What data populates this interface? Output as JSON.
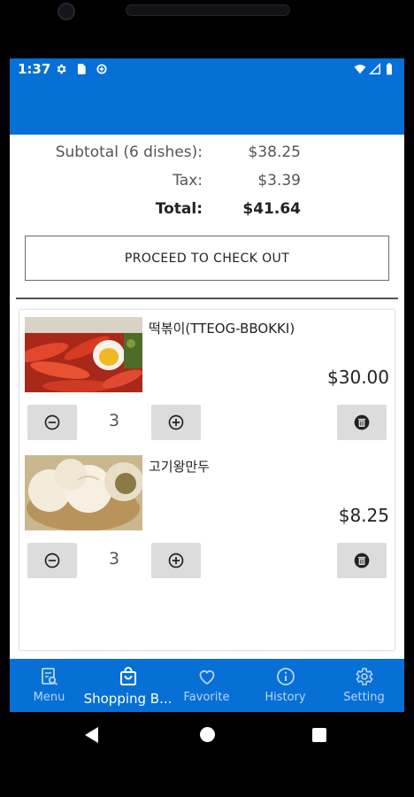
{
  "status_bar": {
    "time": "1:37",
    "left_icons": [
      "gear-icon",
      "sim-card-icon",
      "data-saver-icon"
    ],
    "right_icons": [
      "wifi-icon",
      "signal-icon",
      "battery-icon"
    ]
  },
  "summary": {
    "subtotal_label": "Subtotal (6 dishes):",
    "subtotal_value": "$38.25",
    "tax_label": "Tax:",
    "tax_value": "$3.39",
    "total_label": "Total:",
    "total_value": "$41.64"
  },
  "checkout_button": "PROCEED TO CHECK OUT",
  "cart_items": [
    {
      "name": "떡볶이(TTEOG-BBOKKI)",
      "price": "$30.00",
      "quantity": "3"
    },
    {
      "name": "고기왕만두",
      "price": "$8.25",
      "quantity": "3"
    }
  ],
  "bottom_nav": [
    {
      "label": "Menu",
      "icon": "menu-search-icon",
      "active": false
    },
    {
      "label": "Shopping B...",
      "icon": "shopping-bag-icon",
      "active": true
    },
    {
      "label": "Favorite",
      "icon": "heart-icon",
      "active": false
    },
    {
      "label": "History",
      "icon": "info-icon",
      "active": false
    },
    {
      "label": "Setting",
      "icon": "gear-icon",
      "active": false
    }
  ],
  "colors": {
    "primary": "#0670d6",
    "nav_inactive": "#b9d4f1",
    "button_gray": "#dcdcdc"
  }
}
